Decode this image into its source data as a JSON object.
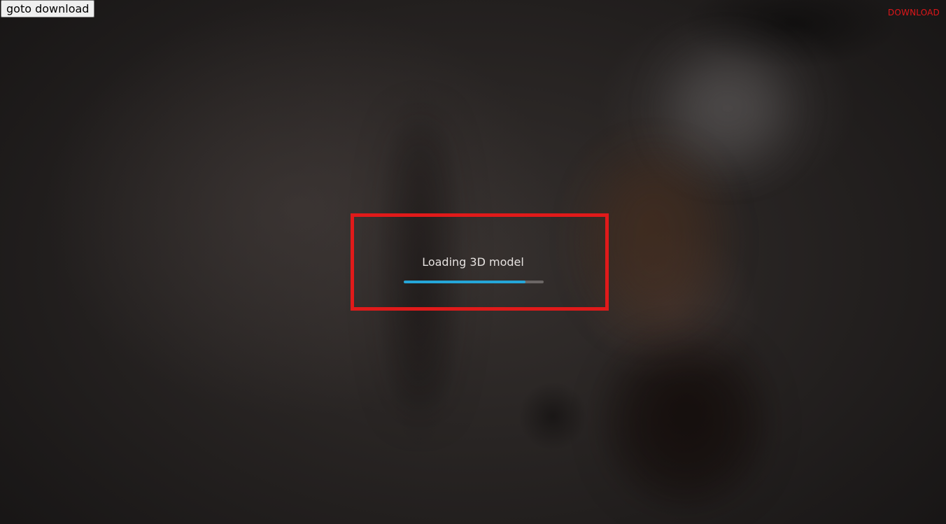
{
  "toolbar": {
    "goto_download_label": "goto download",
    "download_link_label": "DOWNLOAD"
  },
  "loader": {
    "label": "Loading 3D model",
    "progress": 0.87
  },
  "colors": {
    "highlight_frame": "#e01a1a",
    "download_link": "#e0161a",
    "progress_fill": "#25a6d8",
    "progress_track": "#6b6665"
  }
}
